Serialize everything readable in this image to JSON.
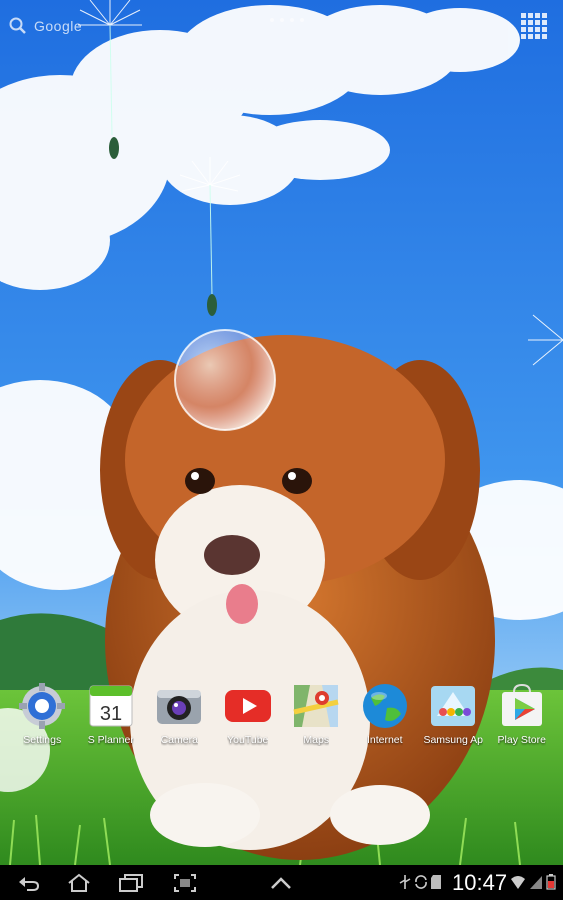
{
  "search": {
    "label": "Google"
  },
  "apps": [
    {
      "label": "Settings",
      "icon": "settings-gear-icon"
    },
    {
      "label": "S Planner",
      "icon": "calendar-icon",
      "date": "31"
    },
    {
      "label": "Camera",
      "icon": "camera-icon"
    },
    {
      "label": "YouTube",
      "icon": "youtube-icon"
    },
    {
      "label": "Maps",
      "icon": "maps-icon"
    },
    {
      "label": "Internet",
      "icon": "globe-icon"
    },
    {
      "label": "Samsung Ap",
      "icon": "samsung-apps-icon"
    },
    {
      "label": "Play Store",
      "icon": "play-store-icon"
    }
  ],
  "navbar": {
    "buttons": [
      "back-icon",
      "home-icon",
      "recent-apps-icon",
      "screenshot-icon",
      "expand-up-icon"
    ],
    "time": "10:47",
    "status_icons": [
      "usb-icon",
      "sync-icon",
      "sd-card-icon",
      "download-icon",
      "wifi-icon",
      "signal-icon",
      "battery-icon"
    ]
  },
  "colors": {
    "sky": "#1b6fd6",
    "grass": "#4caf2e",
    "puppy_fur": "#b5561c",
    "navbar": "#000000"
  }
}
